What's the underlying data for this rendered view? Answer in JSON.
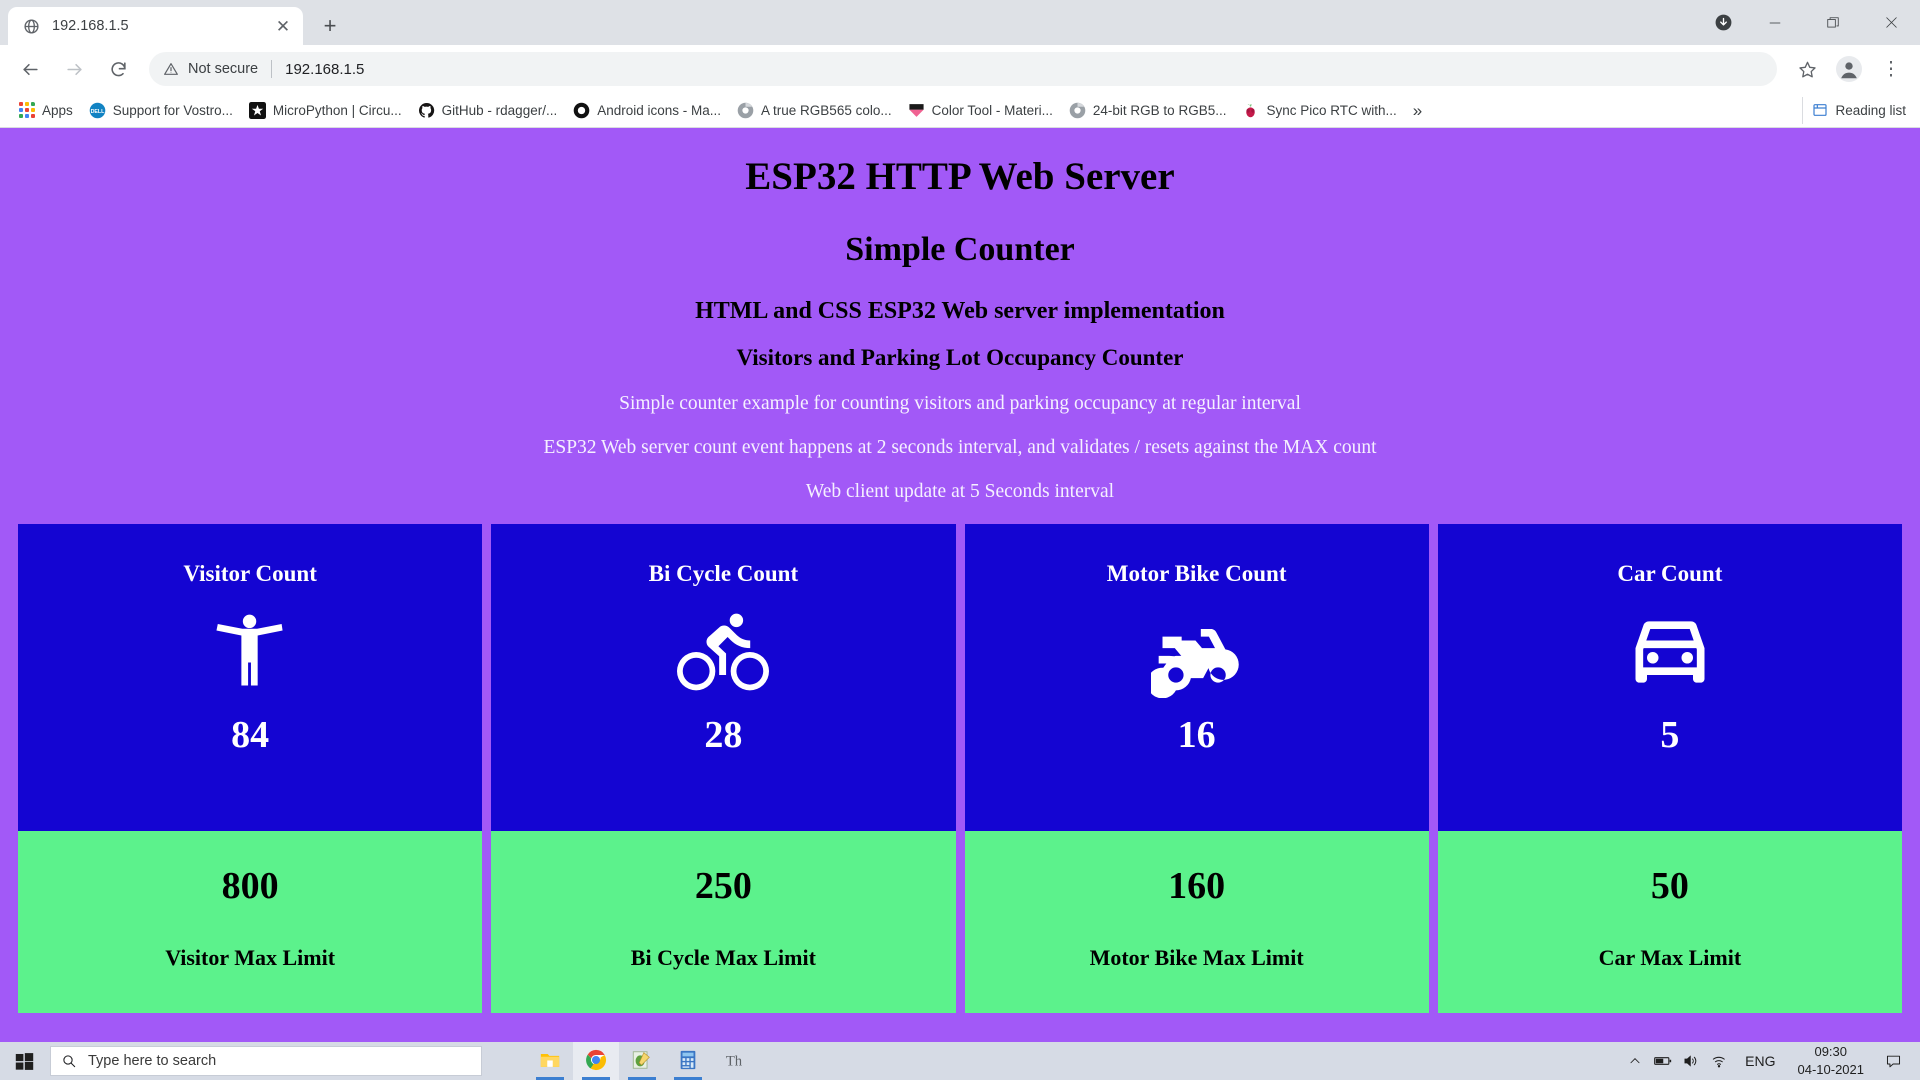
{
  "browser": {
    "tab": {
      "title": "192.168.1.5",
      "favicon": "globe-icon",
      "close": "✕"
    },
    "new_tab": "+",
    "window_controls": {
      "download": "download-icon",
      "minimize": "—",
      "maximize": "❐",
      "close": "✕"
    },
    "toolbar": {
      "back": "←",
      "forward": "→",
      "reload": "⟳",
      "security_label": "Not secure",
      "url": "192.168.1.5",
      "bookmark_star": "☆",
      "profile": "profile-icon",
      "menu": "⋮"
    },
    "bookmarks": {
      "apps_label": "Apps",
      "items": [
        {
          "label": "Support for Vostro...",
          "icon": "dell-icon",
          "color": "#1283c3"
        },
        {
          "label": "MicroPython | Circu...",
          "icon": "micropython-icon",
          "color": "#111111"
        },
        {
          "label": "GitHub - rdagger/...",
          "icon": "github-icon",
          "color": "#111111"
        },
        {
          "label": "Android icons - Ma...",
          "icon": "material-icon",
          "color": "#111111"
        },
        {
          "label": "A true RGB565 colo...",
          "icon": "chrome-doc-icon",
          "color": "#7a7a7a"
        },
        {
          "label": "Color Tool - Materi...",
          "icon": "color-tool-icon",
          "color": "#e91e63"
        },
        {
          "label": "24-bit RGB to RGB5...",
          "icon": "chrome-doc-icon",
          "color": "#7a7a7a"
        },
        {
          "label": "Sync Pico RTC with...",
          "icon": "raspberry-pi-icon",
          "color": "#c51a4a"
        }
      ],
      "overflow": "»",
      "reading_list": "Reading list"
    }
  },
  "page": {
    "title": "ESP32 HTTP Web Server",
    "subtitle": "Simple Counter",
    "heading3": "HTML and CSS ESP32 Web server implementation",
    "heading4": "Visitors and Parking Lot Occupancy Counter",
    "paragraphs": [
      "Simple counter example for counting visitors and parking occupancy at regular interval",
      "ESP32 Web server count event happens at 2 seconds interval, and validates / resets against the MAX count",
      "Web client update at 5 Seconds interval"
    ],
    "background_color": "#a259f7",
    "card_top_color": "#1405d2",
    "card_bottom_color": "#5cf28c",
    "cards": [
      {
        "title": "Visitor Count",
        "icon": "accessibility-icon",
        "count": "84",
        "max": "800",
        "max_label": "Visitor Max Limit"
      },
      {
        "title": "Bi Cycle Count",
        "icon": "pedal-bike-icon",
        "count": "28",
        "max": "250",
        "max_label": "Bi Cycle Max Limit"
      },
      {
        "title": "Motor Bike Count",
        "icon": "two-wheeler-icon",
        "count": "16",
        "max": "160",
        "max_label": "Motor Bike Max Limit"
      },
      {
        "title": "Car Count",
        "icon": "directions-car-icon",
        "count": "5",
        "max": "50",
        "max_label": "Car Max Limit"
      }
    ]
  },
  "taskbar": {
    "start": "windows-logo-icon",
    "search_placeholder": "Type here to search",
    "task_icons": [
      {
        "name": "file-explorer-icon",
        "active": false,
        "running": true
      },
      {
        "name": "google-chrome-icon",
        "active": true,
        "running": true
      },
      {
        "name": "thonny-icon",
        "active": false,
        "running": true
      },
      {
        "name": "calculator-icon",
        "active": false,
        "running": true
      },
      {
        "name": "font-viewer-icon",
        "active": false,
        "running": false
      }
    ],
    "tray": {
      "show_hidden": "∧",
      "battery": "battery-icon",
      "volume": "volume-icon",
      "network": "wifi-icon",
      "language": "ENG",
      "time": "09:30",
      "date": "04-10-2021",
      "action_center": "notification-icon"
    }
  }
}
